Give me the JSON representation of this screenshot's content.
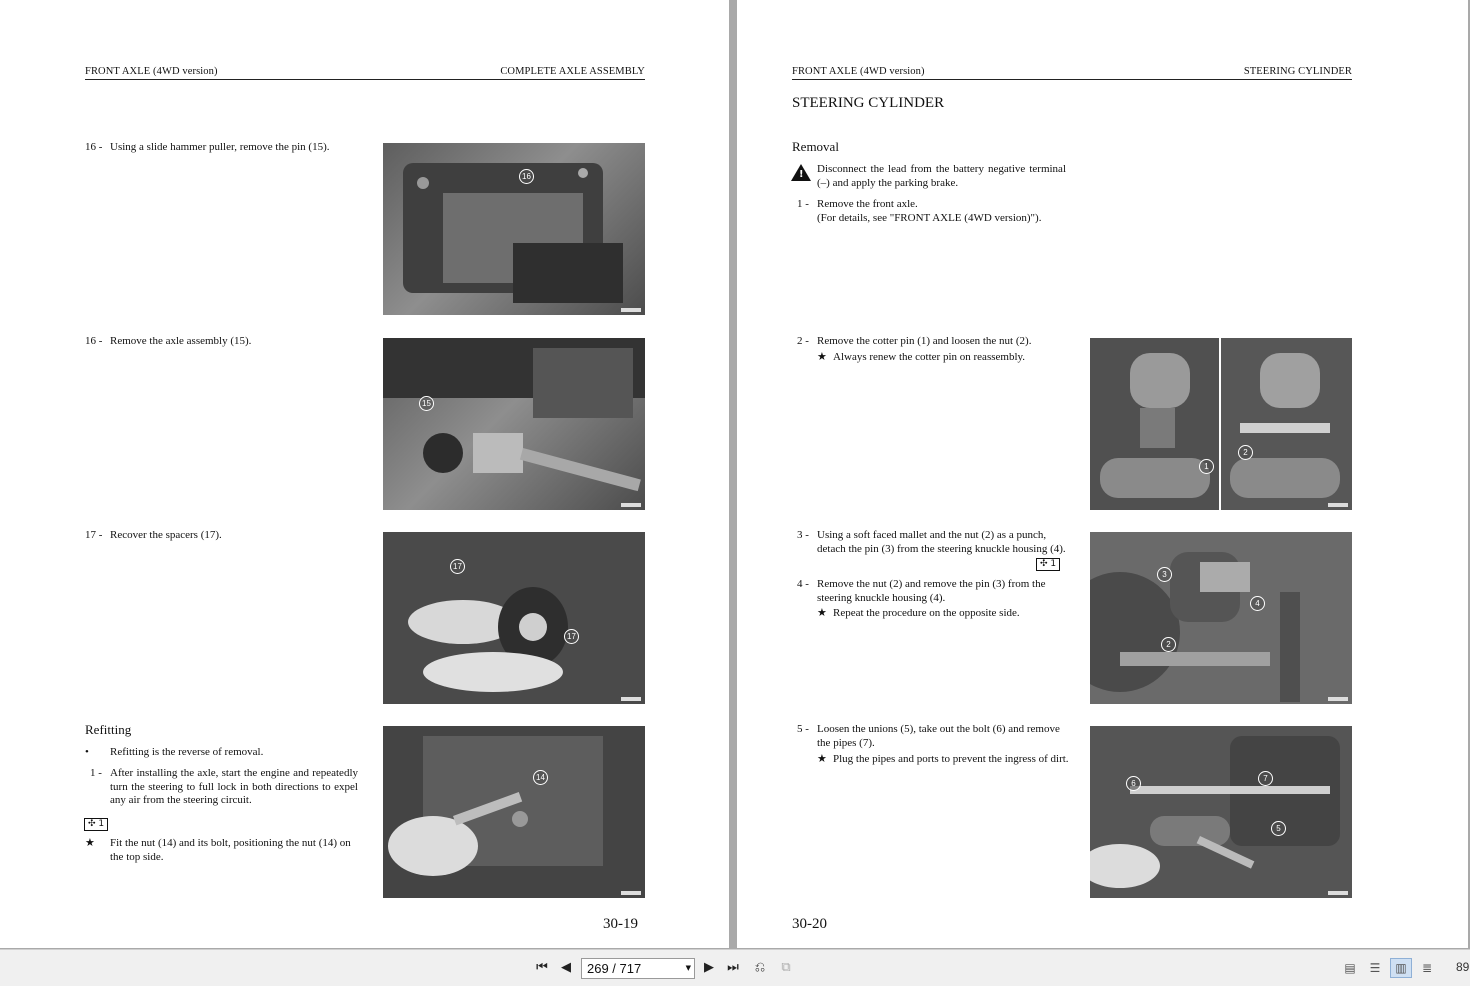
{
  "left_page": {
    "header_left": "FRONT AXLE (4WD version)",
    "header_right": "COMPLETE AXLE ASSEMBLY",
    "steps": [
      {
        "num": "16 -",
        "text": "Using a slide hammer puller, remove the pin (15)."
      },
      {
        "num": "16 -",
        "text": "Remove the axle assembly (15)."
      },
      {
        "num": "17 -",
        "text": "Recover the spacers (17)."
      }
    ],
    "refitting": {
      "title": "Refitting",
      "bullet_mark": "•",
      "bullet": "Refitting is the reverse of removal.",
      "step_num": "1 -",
      "step_text": "After installing the axle, start the engine and repeatedly turn the steering to full lock in both directions to expel any air from the steering circuit.",
      "torque_label": "1",
      "star": "★",
      "note": "Fit the nut (14) and its bolt, positioning the nut (14) on the top side."
    },
    "photo_refs": [
      "16",
      "15",
      "17",
      "17",
      "14"
    ],
    "page_number": "30-19"
  },
  "right_page": {
    "header_left": "FRONT AXLE (4WD version)",
    "header_right": "STEERING CYLINDER",
    "section_title": "STEERING CYLINDER",
    "removal_title": "Removal",
    "warning_symbol": "!",
    "warning": "Disconnect the lead from the battery negative terminal (–) and apply the parking brake.",
    "step1_num": "1 -",
    "step1_line1": "Remove the front axle.",
    "step1_line2": "(For details, see \"FRONT AXLE (4WD version)\").",
    "step2_num": "2 -",
    "step2_text": "Remove the cotter pin (1) and loosen the nut (2).",
    "step2_note": "Always renew the cotter pin on reassembly.",
    "step3_num": "3 -",
    "step3_text": "Using a soft faced mallet and the nut (2) as a punch, detach the pin (3) from the steering knuckle housing (4).",
    "torque_label": "1",
    "step4_num": "4 -",
    "step4_text": "Remove the nut (2) and remove the pin (3) from the steering knuckle housing (4).",
    "step4_note": "Repeat the procedure on the opposite side.",
    "step5_num": "5 -",
    "step5_text": "Loosen the unions (5), take out the bolt (6) and remove the pipes (7).",
    "step5_note": "Plug the pipes and ports to prevent the ingress of dirt.",
    "star": "★",
    "photo_refs": [
      "1",
      "2",
      "3",
      "4",
      "2",
      "6",
      "7",
      "5"
    ],
    "page_number": "30-20"
  },
  "toolbar": {
    "first_icon": "first-page-icon",
    "prev_icon": "previous-page-icon",
    "page_value": "269 / 717",
    "next_icon": "next-page-icon",
    "last_icon": "last-page-icon",
    "zoom": "89"
  }
}
